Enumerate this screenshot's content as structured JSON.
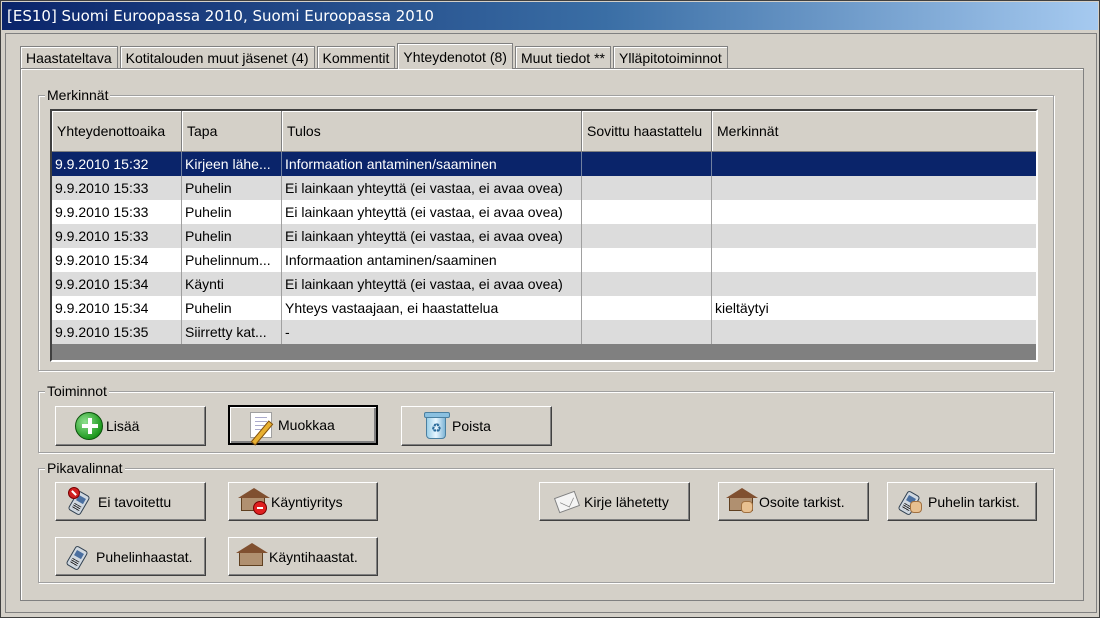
{
  "window": {
    "title": "[ES10] Suomi Euroopassa 2010, Suomi Euroopassa 2010"
  },
  "tabs": [
    {
      "label": "Haastateltava"
    },
    {
      "label": "Kotitalouden muut jäsenet (4)"
    },
    {
      "label": "Kommentit"
    },
    {
      "label": "Yhteydenotot (8)",
      "active": true
    },
    {
      "label": "Muut tiedot **"
    },
    {
      "label": "Ylläpitotoiminnot"
    }
  ],
  "merkinnat": {
    "group_label": "Merkinnät",
    "columns": [
      "Yhteydenottoaika",
      "Tapa",
      "Tulos",
      "Sovittu haastattelu",
      "Merkinnät"
    ],
    "rows": [
      [
        "9.9.2010 15:32",
        "Kirjeen lähe...",
        "Informaation antaminen/saaminen",
        "",
        ""
      ],
      [
        "9.9.2010 15:33",
        "Puhelin",
        "Ei lainkaan yhteyttä (ei vastaa, ei avaa ovea)",
        "",
        ""
      ],
      [
        "9.9.2010 15:33",
        "Puhelin",
        "Ei lainkaan yhteyttä (ei vastaa, ei avaa ovea)",
        "",
        ""
      ],
      [
        "9.9.2010 15:33",
        "Puhelin",
        "Ei lainkaan yhteyttä (ei vastaa, ei avaa ovea)",
        "",
        ""
      ],
      [
        "9.9.2010 15:34",
        "Puhelinnum...",
        "Informaation antaminen/saaminen",
        "",
        ""
      ],
      [
        "9.9.2010 15:34",
        "Käynti",
        "Ei lainkaan yhteyttä (ei vastaa, ei avaa ovea)",
        "",
        ""
      ],
      [
        "9.9.2010 15:34",
        "Puhelin",
        "Yhteys vastaajaan, ei haastattelua",
        "",
        "kieltäytyi"
      ],
      [
        "9.9.2010 15:35",
        "Siirretty kat...",
        "-",
        "",
        ""
      ]
    ]
  },
  "toiminnot": {
    "group_label": "Toiminnot",
    "add_label": "Lisää",
    "edit_label": "Muokkaa",
    "delete_label": "Poista"
  },
  "pikavalinnat": {
    "group_label": "Pikavalinnat",
    "ei_tavoitettu": "Ei tavoitettu",
    "kayntiyritys": "Käyntiyritys",
    "kirje_lahetetty": "Kirje lähetetty",
    "osoite_tarkist": "Osoite tarkist.",
    "puhelin_tarkist": "Puhelin tarkist.",
    "puhelinhaastat": "Puhelinhaastat.",
    "kayntihaastat": "Käyntihaastat."
  },
  "colors": {
    "titlebar_start": "#0a246a",
    "selection": "#0a246a",
    "face": "#d4d0c8"
  }
}
